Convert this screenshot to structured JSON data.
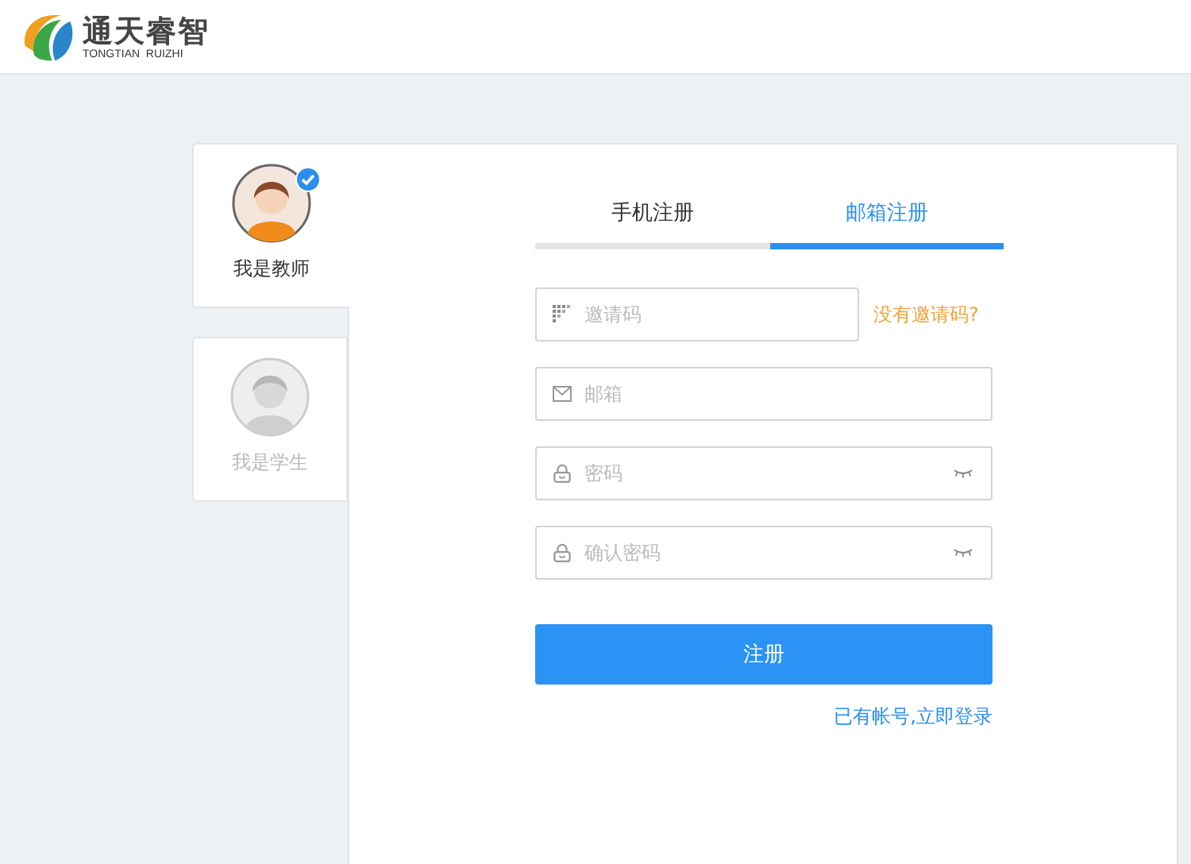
{
  "logo": {
    "name": "通天睿智",
    "subtitle": "TONGTIAN  RUIZHI"
  },
  "roles": [
    {
      "label": "我是教师",
      "selected": true
    },
    {
      "label": "我是学生",
      "selected": false
    }
  ],
  "tabs": [
    {
      "label": "手机注册",
      "selected": false
    },
    {
      "label": "邮箱注册",
      "selected": true
    }
  ],
  "fields": [
    {
      "kind": "invite",
      "placeholder": "邀请码",
      "link": "没有邀请码?"
    },
    {
      "kind": "email",
      "placeholder": "邮箱"
    },
    {
      "kind": "password",
      "placeholder": "密码"
    },
    {
      "kind": "password",
      "placeholder": "确认密码"
    }
  ],
  "submit": "注册",
  "login_link": "已有帐号,立即登录"
}
